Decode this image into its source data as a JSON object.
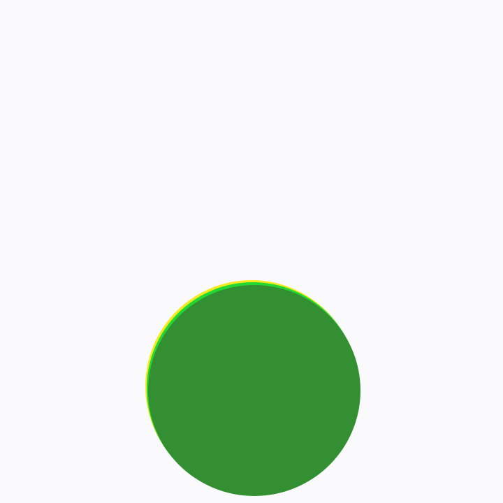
{
  "scene": {
    "background_color": "#fafafc",
    "discs": [
      {
        "name": "yellow-disc",
        "color": "#f5ea1e"
      },
      {
        "name": "bright-green-disc",
        "color": "#22d833"
      },
      {
        "name": "green-disc",
        "color": "#348f33"
      }
    ]
  }
}
